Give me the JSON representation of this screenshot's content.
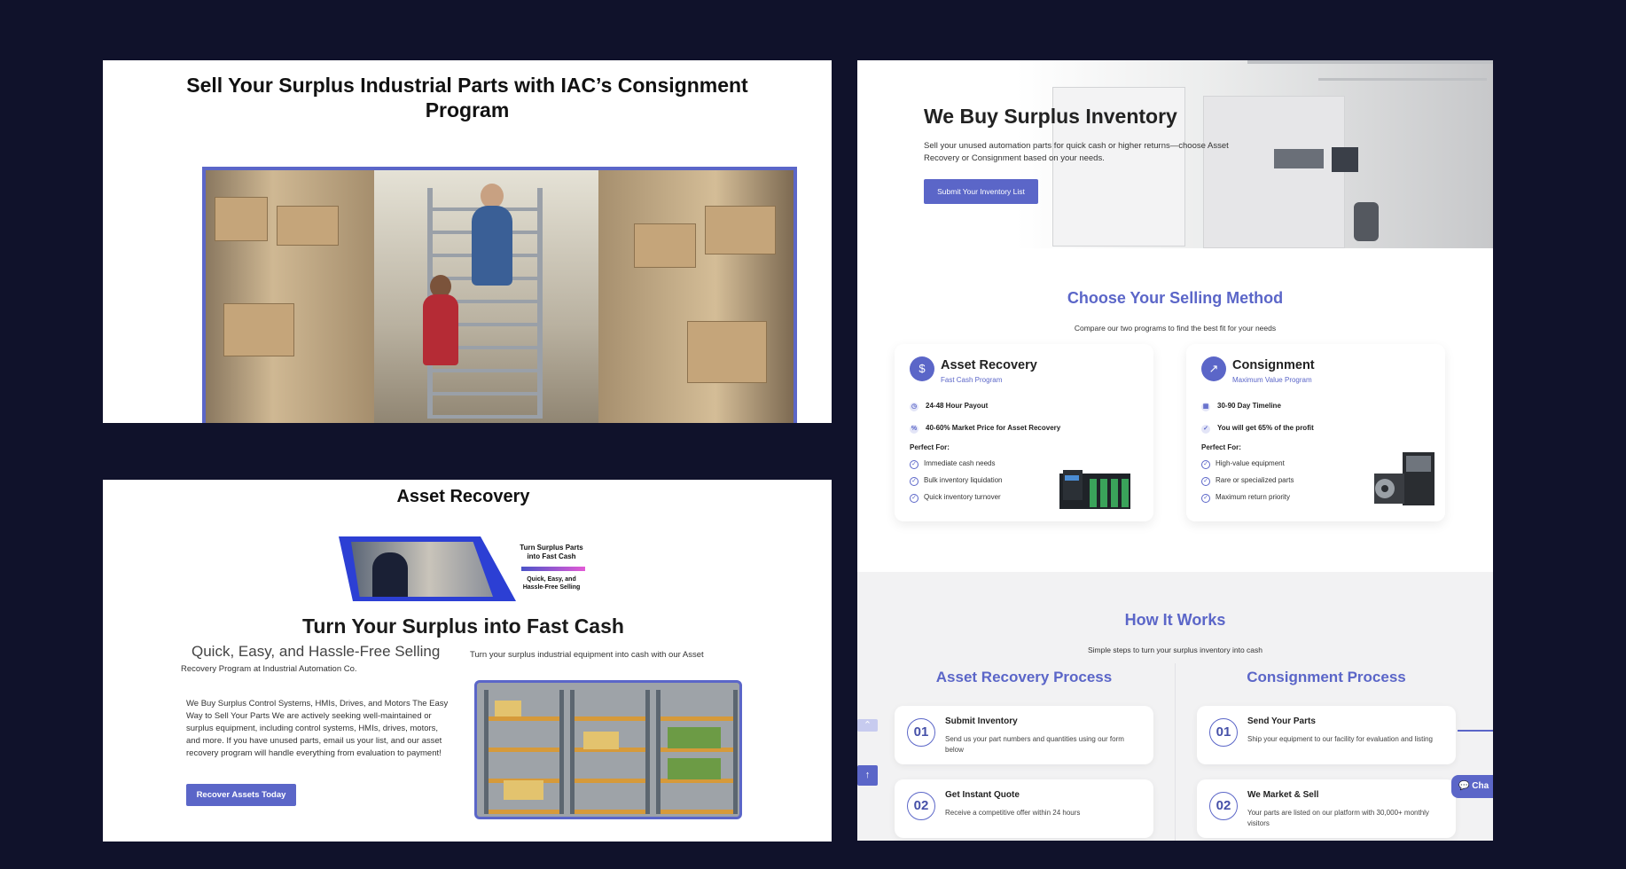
{
  "panel1": {
    "title": "Sell Your Surplus Industrial Parts with IAC’s Consignment Program"
  },
  "panel2": {
    "heading": "Asset Recovery",
    "banner_line1": "Turn Surplus Parts into Fast Cash",
    "banner_line2": "Quick, Easy, and Hassle-Free Selling",
    "big_title": "Turn Your Surplus into Fast Cash",
    "subtitle": "Quick, Easy, and Hassle-Free Selling",
    "subtitle_right": "Turn your surplus industrial equipment into cash with our Asset",
    "subtitle_left": "Recovery Program at Industrial Automation Co.",
    "paragraph": "We Buy Surplus Control Systems, HMIs, Drives, and Motors The Easy Way to Sell Your Parts We are actively seeking well-maintained or surplus equipment, including control systems, HMIs, drives, motors, and more. If you have unused parts, email us your list, and our asset recovery program will handle everything from evaluation to payment!",
    "cta_label": "Recover Assets Today"
  },
  "panel3": {
    "hero": {
      "title": "We Buy Surplus Inventory",
      "text": "Sell your unused automation parts for quick cash or higher returns—choose Asset Recovery or Consignment based on your needs.",
      "button": "Submit Your Inventory List"
    },
    "method": {
      "title": "Choose Your Selling Method",
      "subtitle": "Compare our two programs to find the best fit for your needs"
    },
    "cards": [
      {
        "icon": "dollar-icon",
        "title": "Asset Recovery",
        "subtitle": "Fast Cash Program",
        "feat1": "24-48 Hour Payout",
        "feat2": "40-60% Market Price for Asset Recovery",
        "perfect": "Perfect For:",
        "items": [
          "Immediate cash needs",
          "Bulk inventory liquidation",
          "Quick inventory turnover"
        ]
      },
      {
        "icon": "chart-icon",
        "title": "Consignment",
        "subtitle": "Maximum Value Program",
        "feat1": "30-90 Day Timeline",
        "feat2": "You will get 65% of the profit",
        "perfect": "Perfect For:",
        "items": [
          "High-value equipment",
          "Rare or specialized parts",
          "Maximum return priority"
        ]
      }
    ],
    "how": {
      "title": "How It Works",
      "subtitle": "Simple steps to turn your surplus inventory into cash",
      "left_title": "Asset Recovery Process",
      "right_title": "Consignment Process",
      "left_steps": [
        {
          "num": "01",
          "title": "Submit Inventory",
          "desc": "Send us your part numbers and quantities using our form below"
        },
        {
          "num": "02",
          "title": "Get Instant Quote",
          "desc": "Receive a competitive offer within 24 hours"
        }
      ],
      "right_steps": [
        {
          "num": "01",
          "title": "Send Your Parts",
          "desc": "Ship your equipment to our facility for evaluation and listing"
        },
        {
          "num": "02",
          "title": "We Market & Sell",
          "desc": "Your parts are listed on our platform with 30,000+ monthly visitors"
        }
      ]
    },
    "chat_label": "Cha"
  },
  "colors": {
    "background": "#10122b",
    "accent": "#5b66c8"
  }
}
